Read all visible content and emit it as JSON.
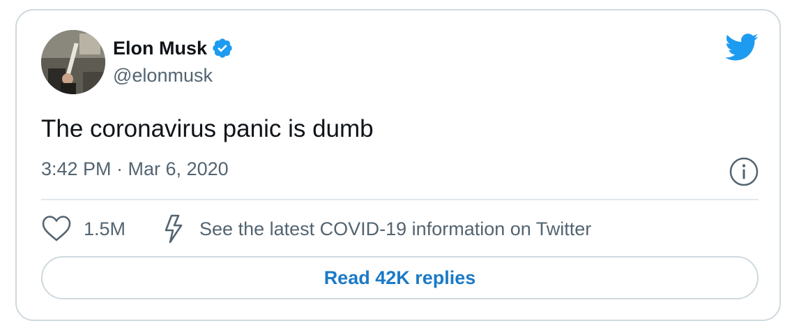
{
  "author": {
    "display_name": "Elon Musk",
    "handle": "@elonmusk",
    "verified": true,
    "avatar_icon": "profile-photo"
  },
  "tweet": {
    "text": "The coronavirus panic is dumb",
    "timestamp": "3:42 PM · Mar 6, 2020"
  },
  "actions": {
    "like_count": "1.5M",
    "covid_link_text": "See the latest COVID-19 information on Twitter"
  },
  "replies_button": {
    "label": "Read 42K replies"
  },
  "icons": {
    "brand": "twitter-bird-icon",
    "verified": "verified-badge-icon",
    "info": "info-icon",
    "like": "heart-icon",
    "covid": "lightning-bolt-icon"
  },
  "colors": {
    "brand_blue": "#1d9bf0",
    "link_blue": "#1b7ac7",
    "secondary_text": "#536471",
    "border": "#cfd9de"
  }
}
